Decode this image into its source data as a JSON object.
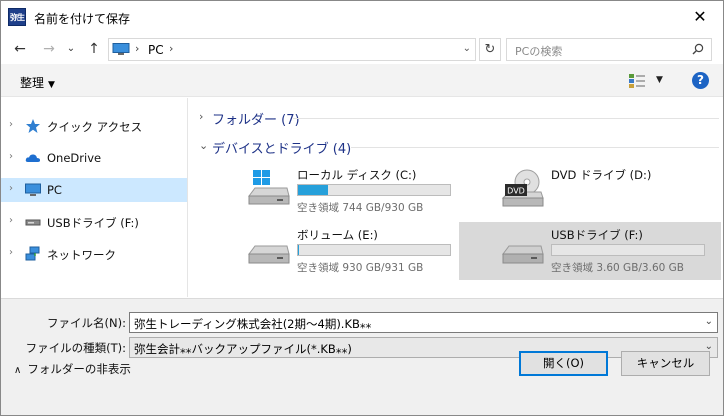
{
  "window": {
    "app_icon_text": "弥生",
    "title": "名前を付けて保存",
    "close_label": "✕"
  },
  "address_bar": {
    "back_label": "←",
    "forward_label": "→",
    "recent_label": "⌄",
    "up_label": "↑",
    "separator": "›",
    "crumb": "PC",
    "dropdown_label": "⌄",
    "refresh_label": "↻"
  },
  "search": {
    "placeholder": "PCの検索"
  },
  "toolbar": {
    "organize_label": "整理",
    "organize_caret": "▼",
    "view_caret": "▼",
    "help_label": "?"
  },
  "nav_pane": {
    "items": [
      {
        "label": "クイック アクセス",
        "icon": "star-icon",
        "selected": false
      },
      {
        "label": "OneDrive",
        "icon": "cloud-icon",
        "selected": false
      },
      {
        "label": "PC",
        "icon": "computer-icon",
        "selected": true
      },
      {
        "label": "USBドライブ (F:)",
        "icon": "usb-drive-icon",
        "selected": false
      },
      {
        "label": "ネットワーク",
        "icon": "network-icon",
        "selected": false
      }
    ],
    "chevron": "›"
  },
  "content": {
    "groups": [
      {
        "title": "フォルダー (7)",
        "chevron": "›",
        "expanded": false
      },
      {
        "title": "デバイスとドライブ (4)",
        "chevron": "⌄",
        "expanded": true
      }
    ],
    "drives": [
      {
        "name": "ローカル ディスク (C:)",
        "free_text": "空き領域 744 GB/930 GB",
        "used_fraction": 0.2,
        "icon": "windows-drive-icon",
        "has_bar": true,
        "selected": false
      },
      {
        "name": "DVD ドライブ (D:)",
        "free_text": "",
        "used_fraction": 0,
        "icon": "dvd-drive-icon",
        "has_bar": false,
        "selected": false
      },
      {
        "name": "ボリューム (E:)",
        "free_text": "空き領域 930 GB/931 GB",
        "used_fraction": 0.001,
        "icon": "hard-drive-icon",
        "has_bar": true,
        "selected": false
      },
      {
        "name": "USBドライブ (F:)",
        "free_text": "空き領域 3.60 GB/3.60 GB",
        "used_fraction": 0,
        "icon": "usb-drive-icon",
        "has_bar": true,
        "selected": true
      }
    ],
    "dvd_label": "DVD"
  },
  "form": {
    "filename_label": "ファイル名(N):",
    "filename_value": "弥生トレーディング株式会社(2期～4期).KB⁎⁎",
    "filetype_label": "ファイルの種類(T):",
    "filetype_value": "弥生会計⁎⁎バックアップファイル(*.KB⁎⁎)",
    "dropdown_label": "⌄"
  },
  "footer": {
    "hide_folders_caret": "∧",
    "hide_folders_label": "フォルダーの非表示",
    "open_label": "開く(O)",
    "cancel_label": "キャンセル"
  },
  "colors": {
    "accent": "#0078d7",
    "selection": "#cce8ff",
    "bar_fill": "#26a0da",
    "group_title": "#1e3287"
  }
}
